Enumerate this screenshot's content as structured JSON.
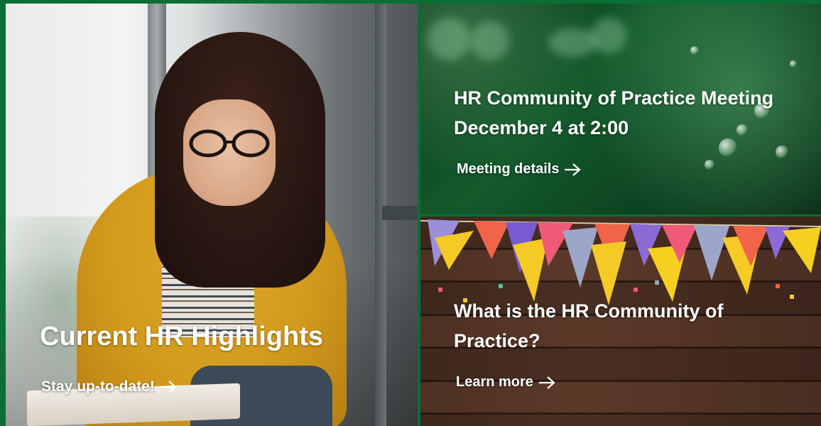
{
  "tiles": {
    "left": {
      "title": "Current HR Highlights",
      "link_label": "Stay up-to-date!",
      "icon": "arrow-right-icon"
    },
    "top_right": {
      "title_line1": "HR Community of Practice Meeting",
      "title_line2": "December 4 at 2:00",
      "link_label": "Meeting details",
      "icon": "arrow-right-icon"
    },
    "bottom_right": {
      "title_line1": "What is the HR Community of",
      "title_line2": "Practice?",
      "link_label": "Learn more",
      "icon": "arrow-right-icon"
    }
  },
  "colors": {
    "frame": "#0a6e35",
    "text": "#ffffff"
  }
}
